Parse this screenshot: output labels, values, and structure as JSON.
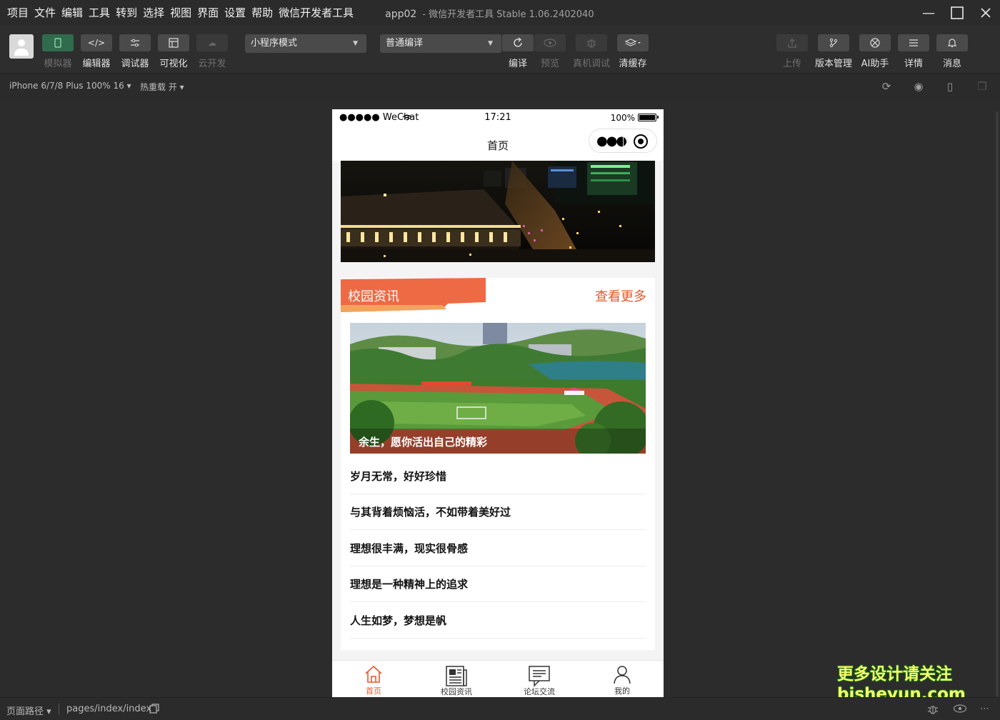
{
  "menu": [
    "项目",
    "文件",
    "编辑",
    "工具",
    "转到",
    "选择",
    "视图",
    "界面",
    "设置",
    "帮助",
    "微信开发者工具"
  ],
  "window": {
    "project": "app02",
    "title": "- 微信开发者工具 Stable 1.06.2402040"
  },
  "toolbar": {
    "simulator": "模拟器",
    "editor": "编辑器",
    "debugger": "调试器",
    "visual": "可视化",
    "cloud": "云开发",
    "mode_select": "小程序模式",
    "compile_select": "普通编译",
    "compile": "编译",
    "preview": "预览",
    "device_debug": "真机调试",
    "clear_cache": "清缓存",
    "upload": "上传",
    "version": "版本管理",
    "ai": "AI助手",
    "details": "详情",
    "messages": "消息"
  },
  "devbar": {
    "device": "iPhone 6/7/8 Plus 100% 16",
    "hot_reload": "热重载 开"
  },
  "phone": {
    "carrier": "●●●●● WeChat",
    "time": "17:21",
    "battery": "100%",
    "page_title": "首页",
    "section_title": "校园资讯",
    "more": "查看更多",
    "featured_caption": "余生，愿你活出自己的精彩",
    "news": [
      "岁月无常，好好珍惜",
      "与其背着烦恼活，不如带着美好过",
      "理想很丰满，现实很骨感",
      "理想是一种精神上的追求",
      "人生如梦，梦想是帆"
    ],
    "tabs": [
      "首页",
      "校园资讯",
      "论坛交流",
      "我的"
    ]
  },
  "bottombar": {
    "path_label": "页面路径",
    "path": "pages/index/index"
  },
  "watermark": {
    "line1": "更多设计请关注",
    "line2": "bisheyun.com"
  },
  "colors": {
    "accent": "#e8582e",
    "bg": "#2c2c2c",
    "toolbar": "#2e2e2e"
  }
}
